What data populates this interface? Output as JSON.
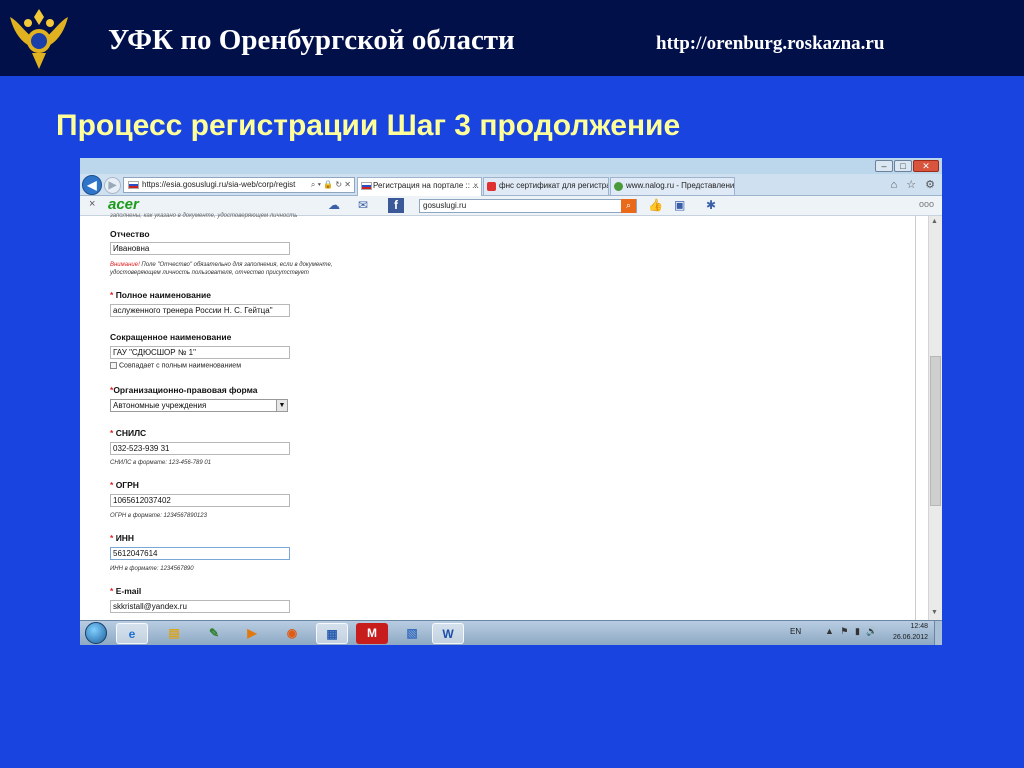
{
  "slide": {
    "header_title": "УФК по Оренбургской области",
    "header_url": "http://orenburg.roskazna.ru",
    "title": "Процесс регистрации Шаг 3 продолжение"
  },
  "browser": {
    "address": "https://esia.gosuslugi.ru/sia-web/corp/regist",
    "address_icons": "⌕ ▾ 🔒 ↻ ✕",
    "tabs": [
      {
        "label": "Регистрация на портале :: ...",
        "active": true
      },
      {
        "label": "фнс сертификат для регистра...",
        "active": false
      },
      {
        "label": "www.nalog.ru - Представлени...",
        "active": false
      }
    ],
    "tab_close": "×",
    "nav_icons": "⌂ ☆ ⚙",
    "window_controls": {
      "minimize": "–",
      "maximize": "□",
      "close": "✕"
    },
    "toolbar_brand": "acer",
    "toolbar_close": "×",
    "toolbar_search_value": "gosuslugi.ru",
    "toolbar_fb": "f",
    "toolbar_dots": "ooo"
  },
  "form": {
    "top_cut_text": "заполнены, как указано в документе, удостоверяющем личность",
    "patronymic": {
      "label": "Отчество",
      "value": "Ивановна"
    },
    "patronymic_hint_warn": "Внимание!",
    "patronymic_hint_1": " Поле \"Отчество\" обязательно для заполнения, если в документе,",
    "patronymic_hint_2": "удостоверяющем личность пользователя, отчество присутствует",
    "required_mark": "*",
    "full_name": {
      "label": "Полное наименование",
      "value": "аслуженного тренера России Н. С. Гейтца\""
    },
    "short_name": {
      "label": "Сокращенное наименование",
      "value": "ГАУ \"СДЮСШОР № 1\""
    },
    "same_as_full": "Совпадает с полным наименованием",
    "legal_form": {
      "label": "Организационно-правовая форма",
      "value": "Автономные учреждения"
    },
    "snils": {
      "label": "СНИЛС",
      "value": "032-523-939 31",
      "hint": "СНИЛС в формате: 123-456-789 01"
    },
    "ogrn": {
      "label": "ОГРН",
      "value": "1065612037402",
      "hint": "ОГРН в формате: 1234567890123"
    },
    "inn": {
      "label": "ИНН",
      "value": "5612047614",
      "hint": "ИНН в формате: 1234567890"
    },
    "email": {
      "label": "E-mail",
      "value": "skkristall@yandex.ru"
    }
  },
  "taskbar": {
    "lang": "EN",
    "tray_icons": "▲ ⚑ ▮ 🔊",
    "time": "12:48",
    "date": "26.06.2012",
    "apps": [
      "ie",
      "explorer",
      "paint",
      "media-player",
      "firefox",
      "control-panel",
      "mcafee",
      "notepad",
      "word"
    ],
    "app_labels": {
      "ie": "e",
      "explorer": "▤",
      "paint": "✎",
      "media": "▶",
      "firefox": "◉",
      "control": "▦",
      "mcafee": "M",
      "notepad": "▧",
      "word": "W"
    }
  },
  "colors": {
    "slide_bg": "#1a44e0",
    "header_bg": "#02104a",
    "title_yellow": "#ffff9a",
    "required_red": "#e02020"
  }
}
